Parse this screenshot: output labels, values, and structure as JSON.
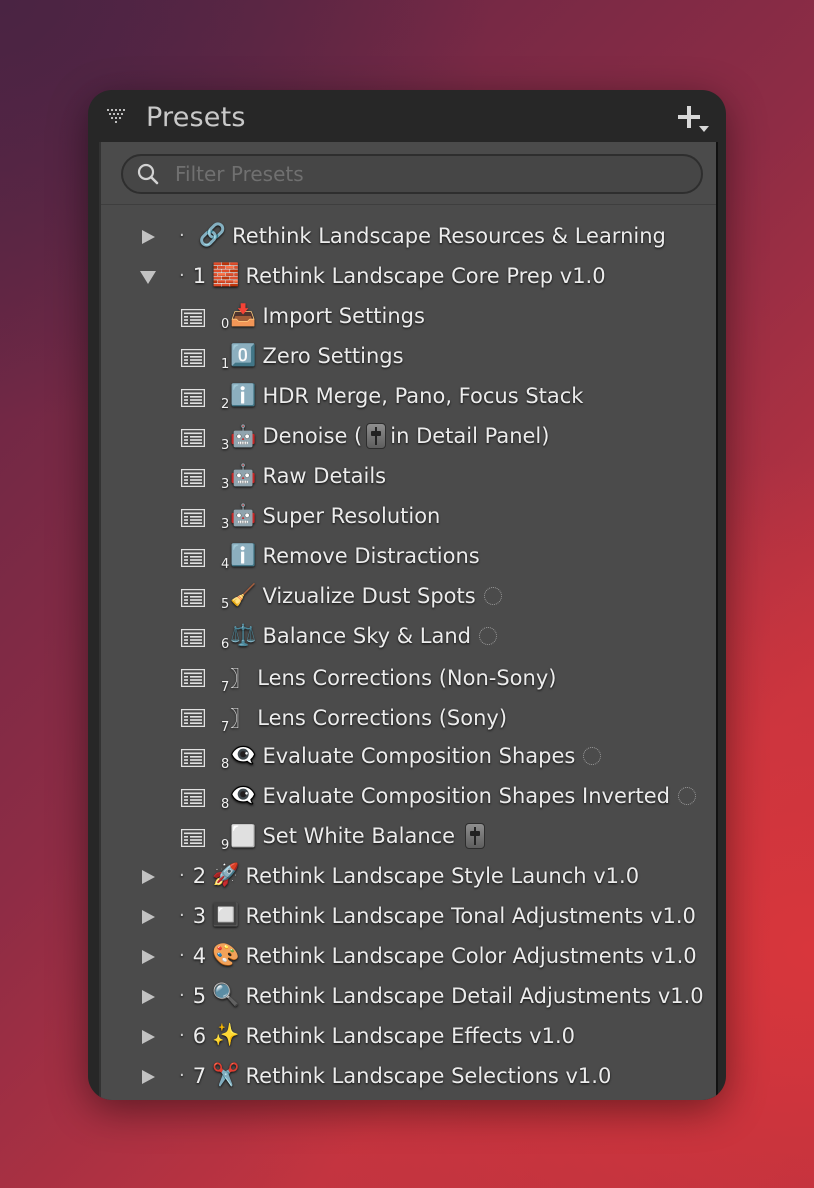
{
  "panel": {
    "title": "Presets",
    "filter_placeholder": "Filter Presets"
  },
  "folders_top": [
    {
      "number": "",
      "emoji": "🔗",
      "label": "Rethink Landscape Resources & Learning",
      "expanded": false
    },
    {
      "number": "1",
      "emoji": "🧱",
      "label": "Rethink Landscape Core Prep v1.0",
      "expanded": true
    }
  ],
  "presets": [
    {
      "index": "0",
      "emoji": "📥",
      "label": "Import Settings",
      "suffix": "none"
    },
    {
      "index": "1",
      "emoji": "0️⃣",
      "label": "Zero Settings",
      "suffix": "none"
    },
    {
      "index": "2",
      "emoji": "ℹ️",
      "label": "HDR Merge, Pano, Focus Stack",
      "suffix": "none"
    },
    {
      "index": "3",
      "emoji": "🤖",
      "label_before": "Denoise (",
      "label_after": "in Detail Panel)",
      "suffix": "inline-slider"
    },
    {
      "index": "3",
      "emoji": "🤖",
      "label": "Raw Details",
      "suffix": "none"
    },
    {
      "index": "3",
      "emoji": "🤖",
      "label": "Super Resolution",
      "suffix": "none"
    },
    {
      "index": "4",
      "emoji": "ℹ️",
      "label": "Remove Distractions",
      "suffix": "none"
    },
    {
      "index": "5",
      "emoji": "🧹",
      "label": "Vizualize Dust Spots",
      "suffix": "ring"
    },
    {
      "index": "6",
      "emoji": "⚖️",
      "label": "Balance Sky & Land",
      "suffix": "ring"
    },
    {
      "index": "7",
      "emoji": "〗",
      "label": "Lens Corrections (Non-Sony)",
      "suffix": "none"
    },
    {
      "index": "7",
      "emoji": "〗",
      "label": "Lens Corrections (Sony)",
      "suffix": "none"
    },
    {
      "index": "8",
      "emoji": "👁‍🗨",
      "label": "Evaluate Composition Shapes",
      "suffix": "ring"
    },
    {
      "index": "8",
      "emoji": "👁‍🗨",
      "label": "Evaluate Composition Shapes Inverted",
      "suffix": "ring"
    },
    {
      "index": "9",
      "emoji": "⬜",
      "label": "Set White Balance",
      "suffix": "slider"
    }
  ],
  "folders_bottom": [
    {
      "number": "2",
      "emoji": "🚀",
      "label": "Rethink Landscape Style Launch v1.0",
      "expanded": false
    },
    {
      "number": "3",
      "emoji": "🔲",
      "label": "Rethink Landscape Tonal Adjustments v1.0",
      "expanded": false
    },
    {
      "number": "4",
      "emoji": "🎨",
      "label": "Rethink Landscape Color Adjustments v1.0",
      "expanded": false
    },
    {
      "number": "5",
      "emoji": "🔍",
      "label": "Rethink Landscape Detail Adjustments v1.0",
      "expanded": false
    },
    {
      "number": "6",
      "emoji": "✨",
      "label": "Rethink Landscape Effects v1.0",
      "expanded": false
    },
    {
      "number": "7",
      "emoji": "✂️",
      "label": "Rethink Landscape Selections v1.0",
      "expanded": false
    }
  ],
  "colors": {
    "panel_bg": "#272727",
    "list_bg": "#4b4b4b",
    "text": "#ececec",
    "title": "#c9c9c9"
  }
}
